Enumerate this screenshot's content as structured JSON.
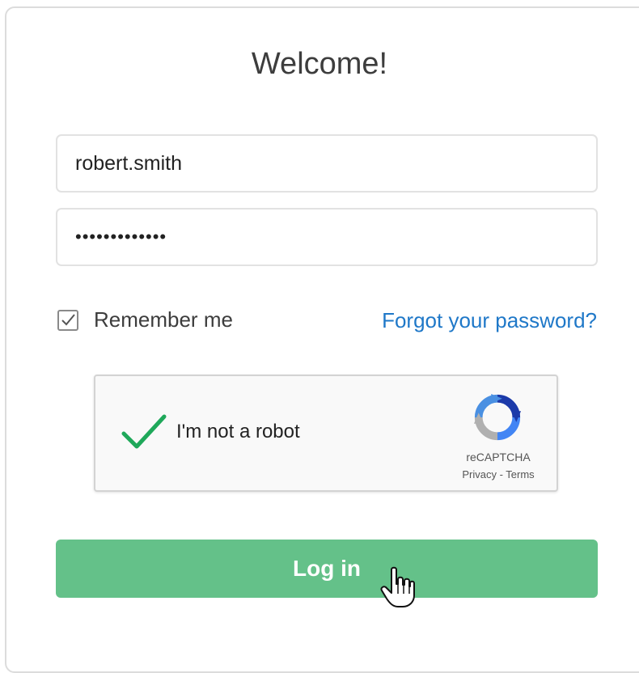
{
  "title": "Welcome!",
  "username": {
    "value": "robert.smith"
  },
  "password": {
    "value": "•••••••••••••"
  },
  "remember": {
    "label": "Remember me",
    "checked": true
  },
  "forgot_link": "Forgot your password?",
  "captcha": {
    "label": "I'm not a robot",
    "brand": "reCAPTCHA",
    "privacy": "Privacy",
    "separator": " - ",
    "terms": "Terms",
    "checked": true
  },
  "login_button": "Log in",
  "colors": {
    "accent_green": "#64c189",
    "link_blue": "#1f78c8",
    "check_green": "#1fa85a"
  },
  "icons": {
    "checkbox": "checkmark-icon",
    "captcha_check": "green-checkmark-icon",
    "captcha_logo": "recaptcha-logo-icon",
    "cursor": "hand-pointer-cursor-icon"
  }
}
